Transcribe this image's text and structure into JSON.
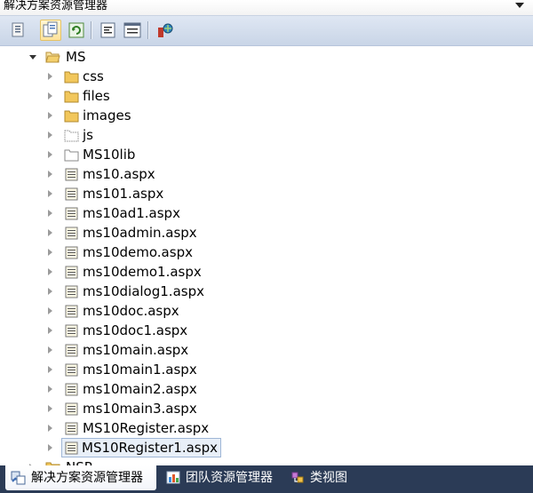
{
  "panel": {
    "title": "解决方案资源管理器"
  },
  "toolbar": {
    "buttons": [
      {
        "name": "properties-button",
        "icon": "properties-icon"
      },
      {
        "name": "show-all-files-button",
        "icon": "show-all-files-icon"
      },
      {
        "name": "refresh-button",
        "icon": "refresh-icon"
      },
      {
        "name": "view-code-button",
        "icon": "view-code-icon"
      },
      {
        "name": "view-designer-button",
        "icon": "view-designer-icon"
      },
      {
        "name": "copy-website-button",
        "icon": "copy-website-icon"
      }
    ]
  },
  "tree": {
    "root": {
      "label": "MS",
      "expanded": true
    },
    "items": [
      {
        "label": "css",
        "type": "folder"
      },
      {
        "label": "files",
        "type": "folder"
      },
      {
        "label": "images",
        "type": "folder"
      },
      {
        "label": "js",
        "type": "folder-empty"
      },
      {
        "label": "MS10lib",
        "type": "folder-empty"
      },
      {
        "label": "ms10.aspx",
        "type": "aspx"
      },
      {
        "label": "ms101.aspx",
        "type": "aspx"
      },
      {
        "label": "ms10ad1.aspx",
        "type": "aspx"
      },
      {
        "label": "ms10admin.aspx",
        "type": "aspx"
      },
      {
        "label": "ms10demo.aspx",
        "type": "aspx"
      },
      {
        "label": "ms10demo1.aspx",
        "type": "aspx"
      },
      {
        "label": "ms10dialog1.aspx",
        "type": "aspx"
      },
      {
        "label": "ms10doc.aspx",
        "type": "aspx"
      },
      {
        "label": "ms10doc1.aspx",
        "type": "aspx"
      },
      {
        "label": "ms10main.aspx",
        "type": "aspx"
      },
      {
        "label": "ms10main1.aspx",
        "type": "aspx"
      },
      {
        "label": "ms10main2.aspx",
        "type": "aspx"
      },
      {
        "label": "ms10main3.aspx",
        "type": "aspx"
      },
      {
        "label": "MS10Register.aspx",
        "type": "aspx"
      },
      {
        "label": "MS10Register1.aspx",
        "type": "aspx",
        "selected": true
      }
    ],
    "partial_next": {
      "label": "NSP"
    }
  },
  "tabs": [
    {
      "label": "解决方案资源管理器",
      "icon": "solution-explorer-icon",
      "active": true
    },
    {
      "label": "团队资源管理器",
      "icon": "team-explorer-icon",
      "active": false
    },
    {
      "label": "类视图",
      "icon": "class-view-icon",
      "active": false
    }
  ],
  "colors": {
    "tab_bar": "#2b3b56",
    "toolbar": "#cfdaea",
    "selection": "#e8eff8",
    "folder": "#f0c659"
  }
}
